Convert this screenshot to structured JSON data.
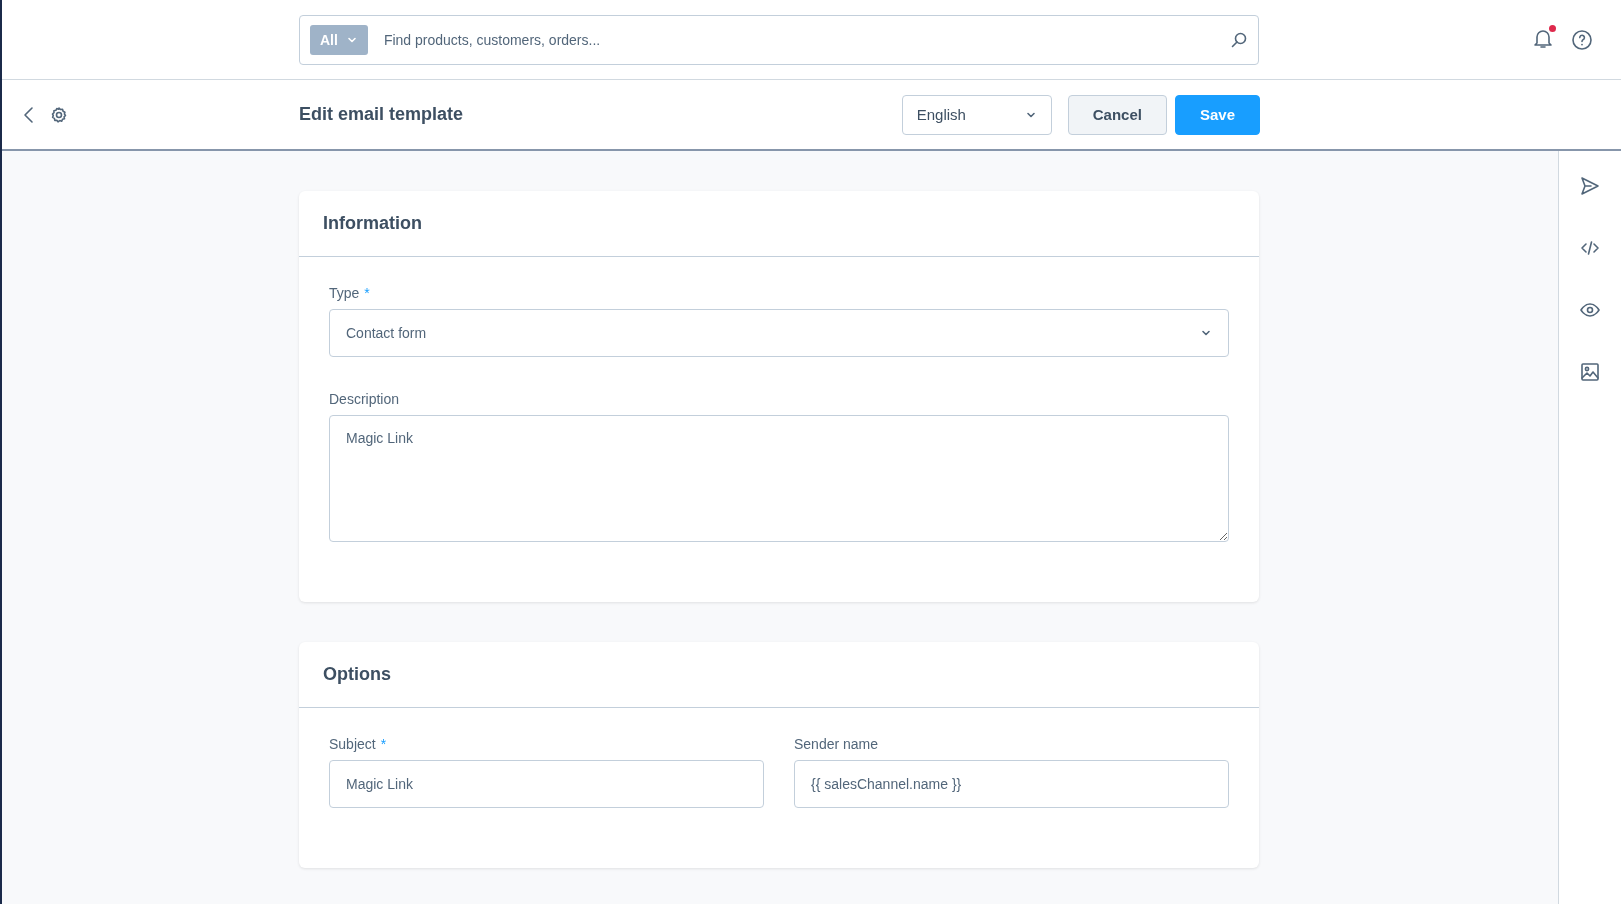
{
  "search": {
    "scope": "All",
    "placeholder": "Find products, customers, orders..."
  },
  "notifications": {
    "unread": true
  },
  "header": {
    "title": "Edit email template",
    "language": "English",
    "buttons": [
      {
        "label": "Cancel",
        "kind": "secondary"
      },
      {
        "label": "Save",
        "kind": "primary"
      }
    ]
  },
  "cards": [
    {
      "title": "Information",
      "rows": [
        [
          {
            "label": "Type",
            "required_mark": "*",
            "kind": "select",
            "value": "Contact form"
          }
        ],
        [
          {
            "label": "Description",
            "kind": "textarea",
            "value": "Magic Link"
          }
        ]
      ]
    },
    {
      "title": "Options",
      "rows": [
        [
          {
            "label": "Subject",
            "required_mark": "*",
            "kind": "text",
            "value": "Magic Link"
          },
          {
            "label": "Sender name",
            "kind": "text",
            "value": "{{ salesChannel.name }}"
          }
        ]
      ]
    }
  ],
  "sidebar": {
    "items": [
      {
        "kind": "send"
      },
      {
        "kind": "code"
      },
      {
        "kind": "preview"
      },
      {
        "kind": "media"
      }
    ]
  }
}
